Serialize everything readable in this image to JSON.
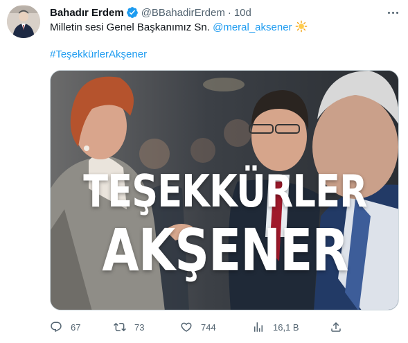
{
  "author": {
    "name": "Bahadır Erdem",
    "handle": "@BBahadirErdem",
    "separator": "·",
    "time": "10d"
  },
  "tweet": {
    "text_prefix": "Milletin sesi Genel Başkanımız Sn. ",
    "mention": "@meral_aksener",
    "emoji_icon": "sun-icon",
    "hashtag": "#TeşekkürlerAkşener"
  },
  "media": {
    "headline_line1": "TEŞEKKÜRLER",
    "headline_line2": "AKŞENER"
  },
  "actions": {
    "replies": "67",
    "retweets": "73",
    "likes": "744",
    "views": "16,1 B"
  },
  "colors": {
    "link": "#1d9bf0",
    "secondary_text": "#536471",
    "verified": "#1d9bf0"
  }
}
